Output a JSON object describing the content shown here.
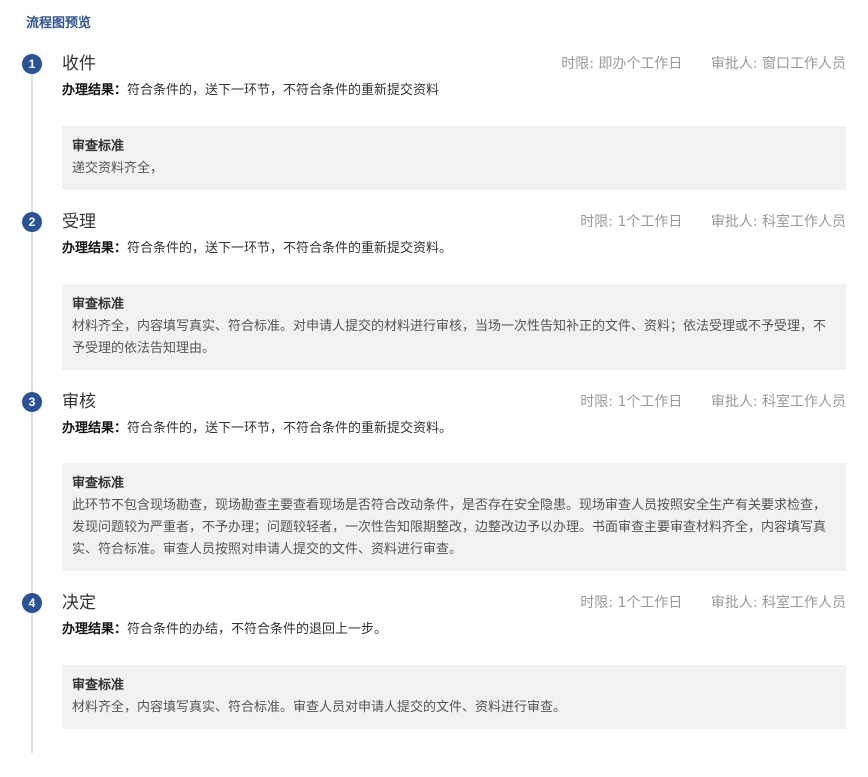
{
  "page": {
    "title": "流程图预览"
  },
  "labels": {
    "result_label": "办理结果：",
    "standard_title": "审查标准"
  },
  "colors": {
    "title": "#2f5597",
    "step_circle": "#2a5298",
    "standard_bg": "#f1f2f3",
    "meta_text": "#999999"
  },
  "steps": [
    {
      "number": "1",
      "name": "收件",
      "time_limit": "时限: 即办个工作日",
      "approver": "审批人: 窗口工作人员",
      "result": "符合条件的，送下一环节，不符合条件的重新提交资料",
      "standard": "递交资料齐全，"
    },
    {
      "number": "2",
      "name": "受理",
      "time_limit": "时限: 1个工作日",
      "approver": "审批人: 科室工作人员",
      "result": "符合条件的，送下一环节，不符合条件的重新提交资料。",
      "standard": "材料齐全，内容填写真实、符合标准。对申请人提交的材料进行审核，当场一次性告知补正的文件、资料；依法受理或不予受理，不予受理的依法告知理由。"
    },
    {
      "number": "3",
      "name": "审核",
      "time_limit": "时限: 1个工作日",
      "approver": "审批人: 科室工作人员",
      "result": "符合条件的，送下一环节，不符合条件的重新提交资料。",
      "standard": "此环节不包含现场勘查，现场勘查主要查看现场是否符合改动条件，是否存在安全隐患。现场审查人员按照安全生产有关要求检查，发现问题较为严重者，不予办理；问题较轻者，一次性告知限期整改，边整改边予以办理。书面审查主要审查材料齐全，内容填写真实、符合标准。审查人员按照对申请人提交的文件、资料进行审查。"
    },
    {
      "number": "4",
      "name": "决定",
      "time_limit": "时限: 1个工作日",
      "approver": "审批人: 科室工作人员",
      "result": "符合条件的办结，不符合条件的退回上一步。",
      "standard": "材料齐全，内容填写真实、符合标准。审查人员对申请人提交的文件、资料进行审查。"
    }
  ]
}
